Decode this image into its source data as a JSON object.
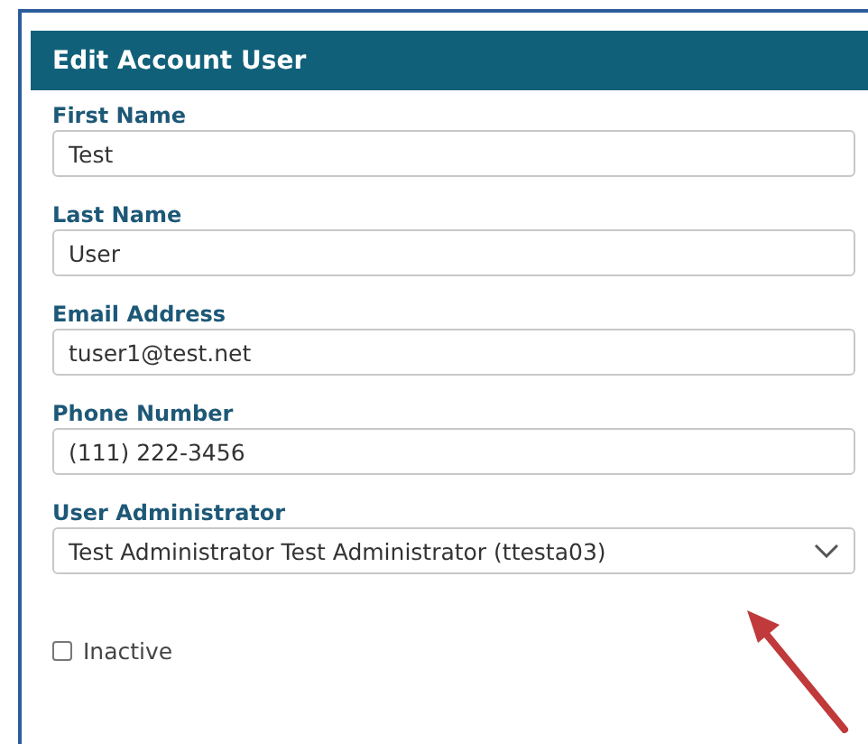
{
  "panel": {
    "title": "Edit Account User"
  },
  "fields": [
    {
      "kind": "text",
      "label": "First Name",
      "value": "Test"
    },
    {
      "kind": "text",
      "label": "Last Name",
      "value": "User"
    },
    {
      "kind": "text",
      "label": "Email Address",
      "value": "tuser1@test.net"
    },
    {
      "kind": "text",
      "label": "Phone Number",
      "value": "(111) 222-3456"
    },
    {
      "kind": "select",
      "label": "User Administrator",
      "value": "Test Administrator Test Administrator (ttesta03)"
    }
  ],
  "checkbox": {
    "label": "Inactive",
    "checked": false
  }
}
